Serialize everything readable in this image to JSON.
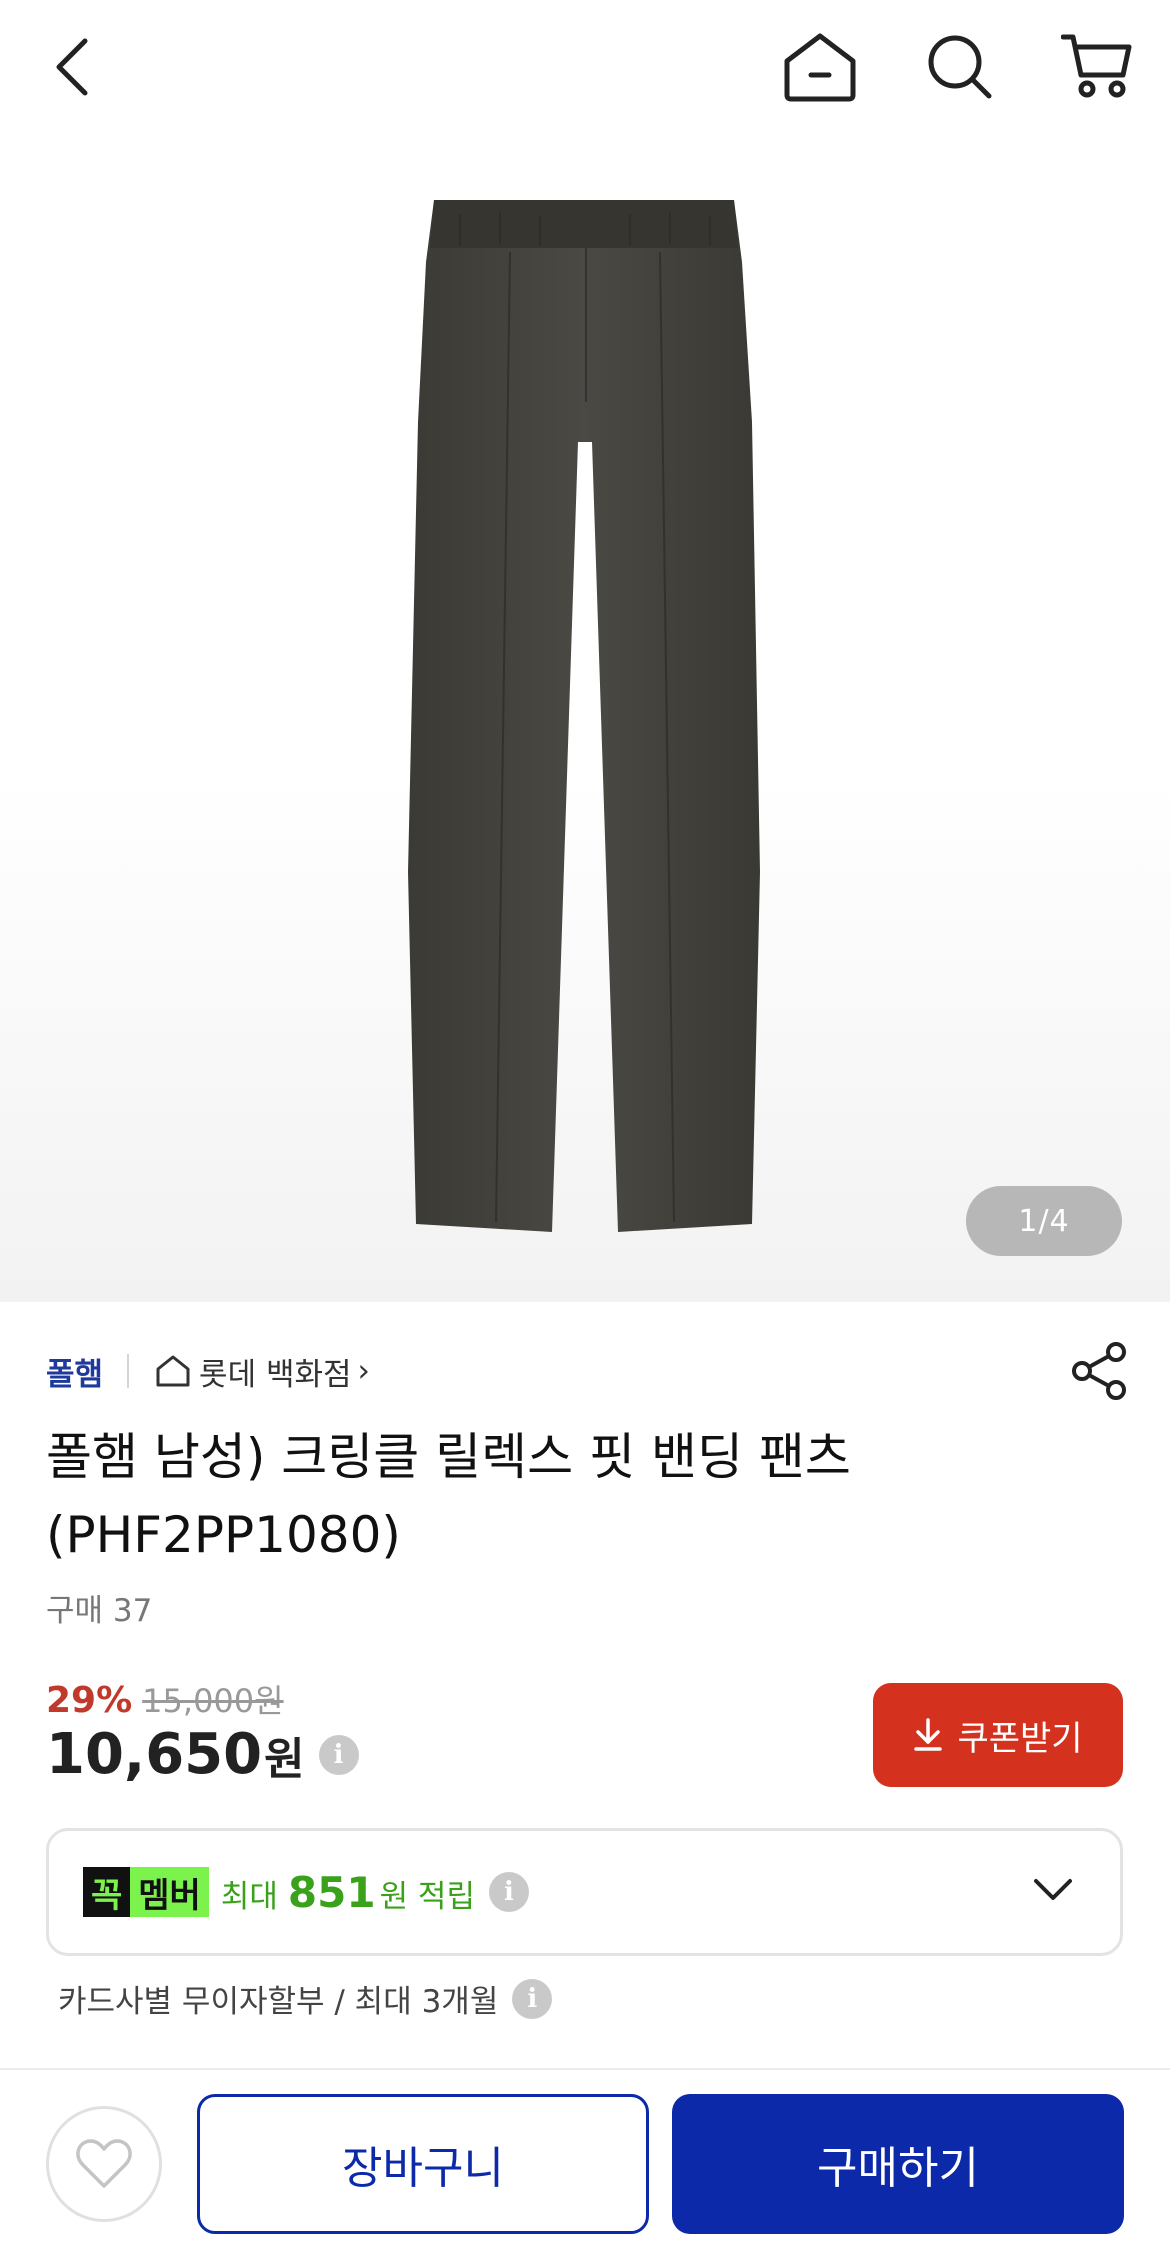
{
  "header": {
    "back_icon": "chevron-left-icon",
    "home_icon": "home-icon",
    "search_icon": "search-icon",
    "cart_icon": "cart-icon"
  },
  "gallery": {
    "counter_current": "1",
    "counter_total": "/4",
    "product_image": "dark-gray-pants"
  },
  "product": {
    "brand": "폴햄",
    "store_label": "롯데 백화점",
    "store_arrow": "›",
    "title": "폴햄 남성) 크링클 릴렉스 핏 밴딩 팬츠 (PHF2PP1080)",
    "purchase_count": "구매 37"
  },
  "price": {
    "discount_rate": "29%",
    "original_price": "15,000원",
    "sale_price": "10,650",
    "currency": "원",
    "info_icon": "i"
  },
  "coupon": {
    "label": "쿠폰받기",
    "icon": "download-icon"
  },
  "membership": {
    "badge_part1": "꼭",
    "badge_part2": "멤버",
    "prefix": "최대",
    "amount": "851",
    "suffix": "원 적립",
    "info_icon": "i"
  },
  "installment": {
    "text": "카드사별 무이자할부 / 최대 3개월",
    "info_icon": "i"
  },
  "actions": {
    "cart_label": "장바구니",
    "buy_label": "구매하기"
  },
  "colors": {
    "brand_blue": "#0b29a8",
    "discount_red": "#c0392b",
    "coupon_red": "#d5311f",
    "member_green": "#3aa11b"
  }
}
